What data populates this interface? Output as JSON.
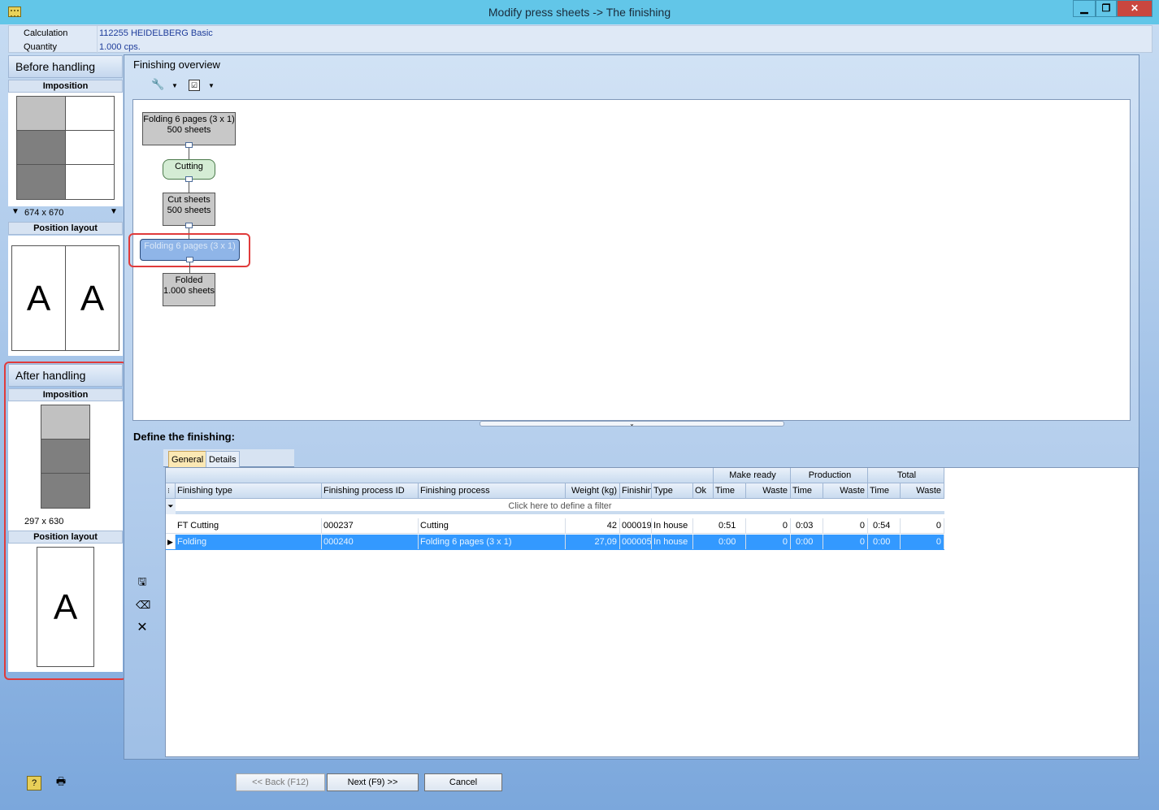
{
  "window": {
    "title": "Modify press sheets -> The finishing",
    "min_glyph": "▁",
    "max_glyph": "❐",
    "close_glyph": "✕"
  },
  "info": {
    "calculation_label": "Calculation",
    "calculation_value": "112255 HEIDELBERG Basic",
    "quantity_label": "Quantity",
    "quantity_value": "1.000 cps."
  },
  "before": {
    "title": "Before handling",
    "imposition_label": "Imposition",
    "size": "674 x 670",
    "position_layout_label": "Position layout",
    "glyph": "A"
  },
  "after": {
    "title": "After handling",
    "imposition_label": "Imposition",
    "size": "297 x 630",
    "position_layout_label": "Position layout",
    "glyph": "A"
  },
  "overview": {
    "title": "Finishing overview",
    "nodes": {
      "n1": "Folding 6 pages (3 x 1)\n500 sheets",
      "n2": "Cutting",
      "n3": "Cut sheets\n500 sheets",
      "n4": "Folding 6 pages (3 x 1)",
      "n5": "Folded\n1.000 sheets"
    }
  },
  "define": {
    "title": "Define the finishing:",
    "tabs": [
      "General",
      "Details"
    ],
    "group_headers": [
      "Make ready",
      "Production",
      "Total"
    ],
    "columns": [
      "Finishing type",
      "Finishing process ID",
      "Finishing process",
      "Weight (kg)",
      "Finishin",
      "Type",
      "Ok",
      "Time",
      "Waste",
      "Time",
      "Waste",
      "Time",
      "Waste"
    ],
    "filter_text": "Click here to define a filter",
    "rows": [
      {
        "type": "FT Cutting",
        "pid": "000237",
        "process": "Cutting",
        "weight": "42",
        "fin": "000019",
        "kind": "In house",
        "ok": "green",
        "mr_time": "0:51",
        "mr_waste": "0",
        "p_time": "0:03",
        "p_waste": "0",
        "t_time": "0:54",
        "t_waste": "0"
      },
      {
        "type": "Folding",
        "pid": "000240",
        "process": "Folding 6 pages (3 x 1)",
        "weight": "27,09",
        "fin": "000005",
        "kind": "In house",
        "ok": "green",
        "mr_time": "0:00",
        "mr_waste": "0",
        "p_time": "0:00",
        "p_waste": "0",
        "t_time": "0:00",
        "t_waste": "0"
      }
    ]
  },
  "footer": {
    "back": "<< Back (F12)",
    "next": "Next (F9) >>",
    "cancel": "Cancel"
  },
  "colors": {
    "selection": "#3399ff",
    "highlight": "#e03b3b",
    "titlebar": "#62c6e8"
  }
}
